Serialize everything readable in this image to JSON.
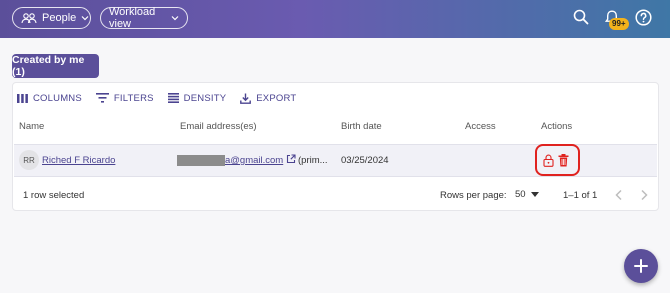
{
  "topbar": {
    "people_label": "People",
    "workload_label": "Workload view",
    "notification_badge": "99+"
  },
  "filter_chip": "Created by me (1)",
  "toolbar": {
    "columns": "COLUMNS",
    "filters": "FILTERS",
    "density": "DENSITY",
    "export": "EXPORT"
  },
  "table": {
    "headers": [
      "Name",
      "Email address(es)",
      "Birth date",
      "Access",
      "Actions"
    ],
    "rows": [
      {
        "initials": "RR",
        "name": "Riched F Ricardo",
        "email_visible": "a@gmail.com",
        "email_suffix": "(prim...",
        "birth_date": "03/25/2024",
        "access": ""
      }
    ]
  },
  "footer": {
    "selected": "1 row selected",
    "rows_per_page_label": "Rows per page:",
    "rows_per_page_value": "50",
    "range": "1–1 of 1"
  },
  "colors": {
    "brand": "#5b4f9a",
    "link": "#4b4490",
    "danger": "#e0221f"
  }
}
